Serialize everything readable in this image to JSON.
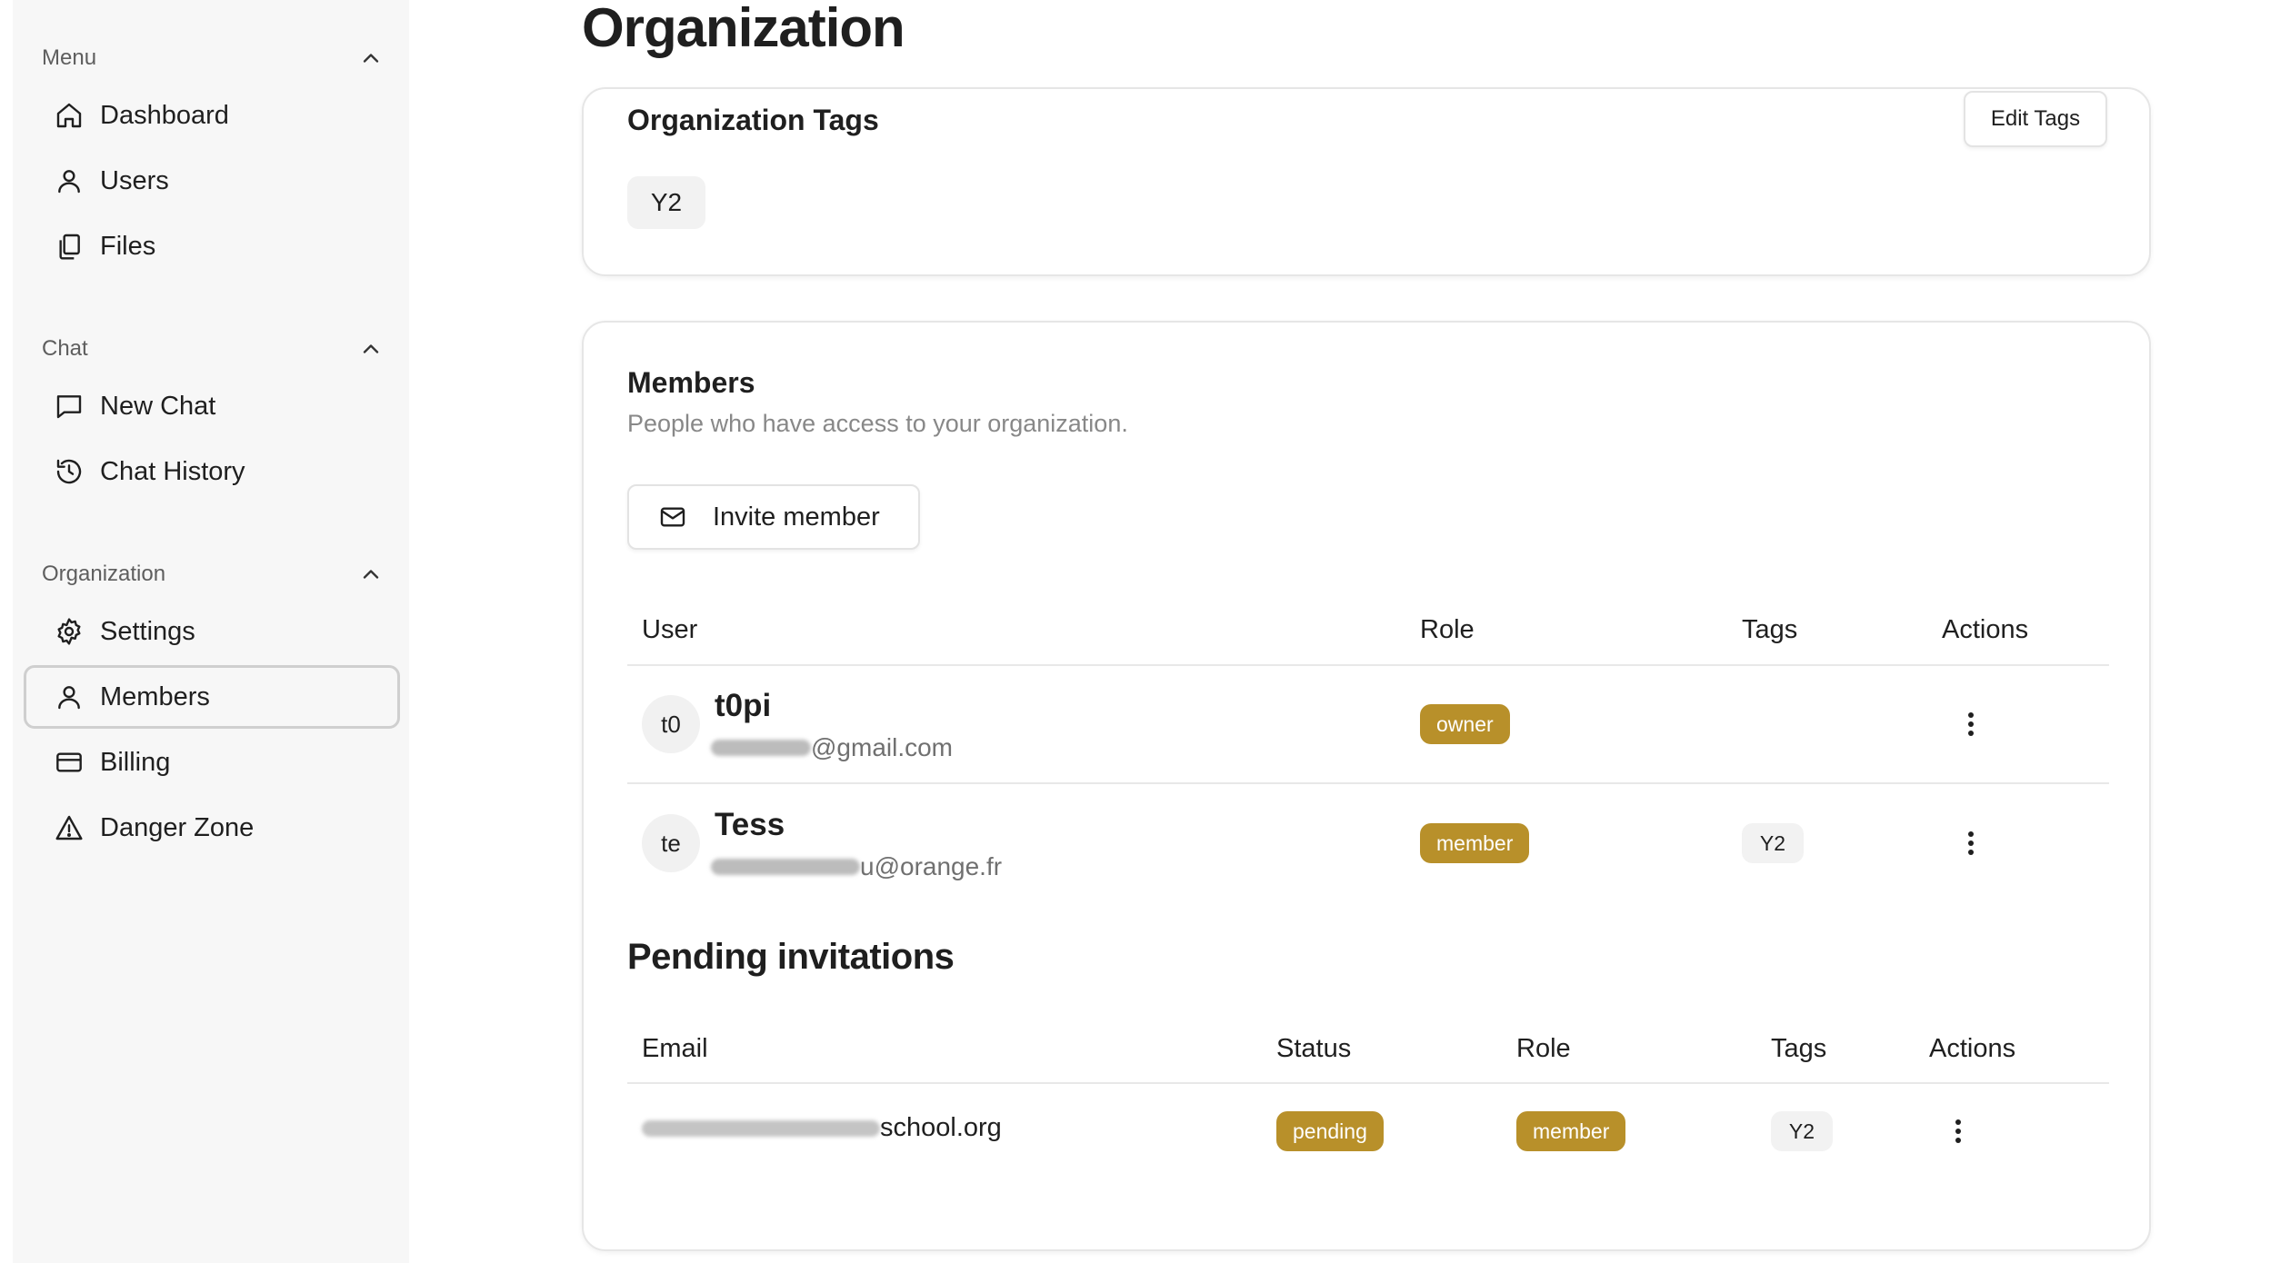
{
  "sidebar": {
    "sections": [
      {
        "title": "Menu",
        "items": [
          {
            "label": "Dashboard",
            "icon": "home-icon"
          },
          {
            "label": "Users",
            "icon": "user-icon"
          },
          {
            "label": "Files",
            "icon": "files-icon"
          }
        ]
      },
      {
        "title": "Chat",
        "items": [
          {
            "label": "New Chat",
            "icon": "message-icon"
          },
          {
            "label": "Chat History",
            "icon": "history-icon"
          }
        ]
      },
      {
        "title": "Organization",
        "items": [
          {
            "label": "Settings",
            "icon": "gear-icon"
          },
          {
            "label": "Members",
            "icon": "user-icon",
            "active": true
          },
          {
            "label": "Billing",
            "icon": "card-icon"
          },
          {
            "label": "Danger Zone",
            "icon": "warning-icon"
          }
        ]
      }
    ]
  },
  "page": {
    "title": "Organization"
  },
  "org_tags": {
    "title": "Organization Tags",
    "edit_label": "Edit Tags",
    "tags": [
      "Y2"
    ]
  },
  "members": {
    "title": "Members",
    "subtitle": "People who have access to your organization.",
    "invite_label": "Invite member",
    "columns": {
      "user": "User",
      "role": "Role",
      "tags": "Tags",
      "actions": "Actions"
    },
    "rows": [
      {
        "initials": "t0",
        "name": "t0pi",
        "email_visible": "@gmail.com",
        "role": "owner",
        "tags": []
      },
      {
        "initials": "te",
        "name": "Tess",
        "email_visible": "u@orange.fr",
        "role": "member",
        "tags": [
          "Y2"
        ]
      }
    ]
  },
  "pending": {
    "title": "Pending invitations",
    "columns": {
      "email": "Email",
      "status": "Status",
      "role": "Role",
      "tags": "Tags",
      "actions": "Actions"
    },
    "rows": [
      {
        "email_visible": "school.org",
        "status": "pending",
        "role": "member",
        "tags": [
          "Y2"
        ]
      }
    ]
  },
  "colors": {
    "badge": "#b8902a",
    "chip": "#f2f2f2",
    "sidebar_bg": "#f7f7f7"
  }
}
